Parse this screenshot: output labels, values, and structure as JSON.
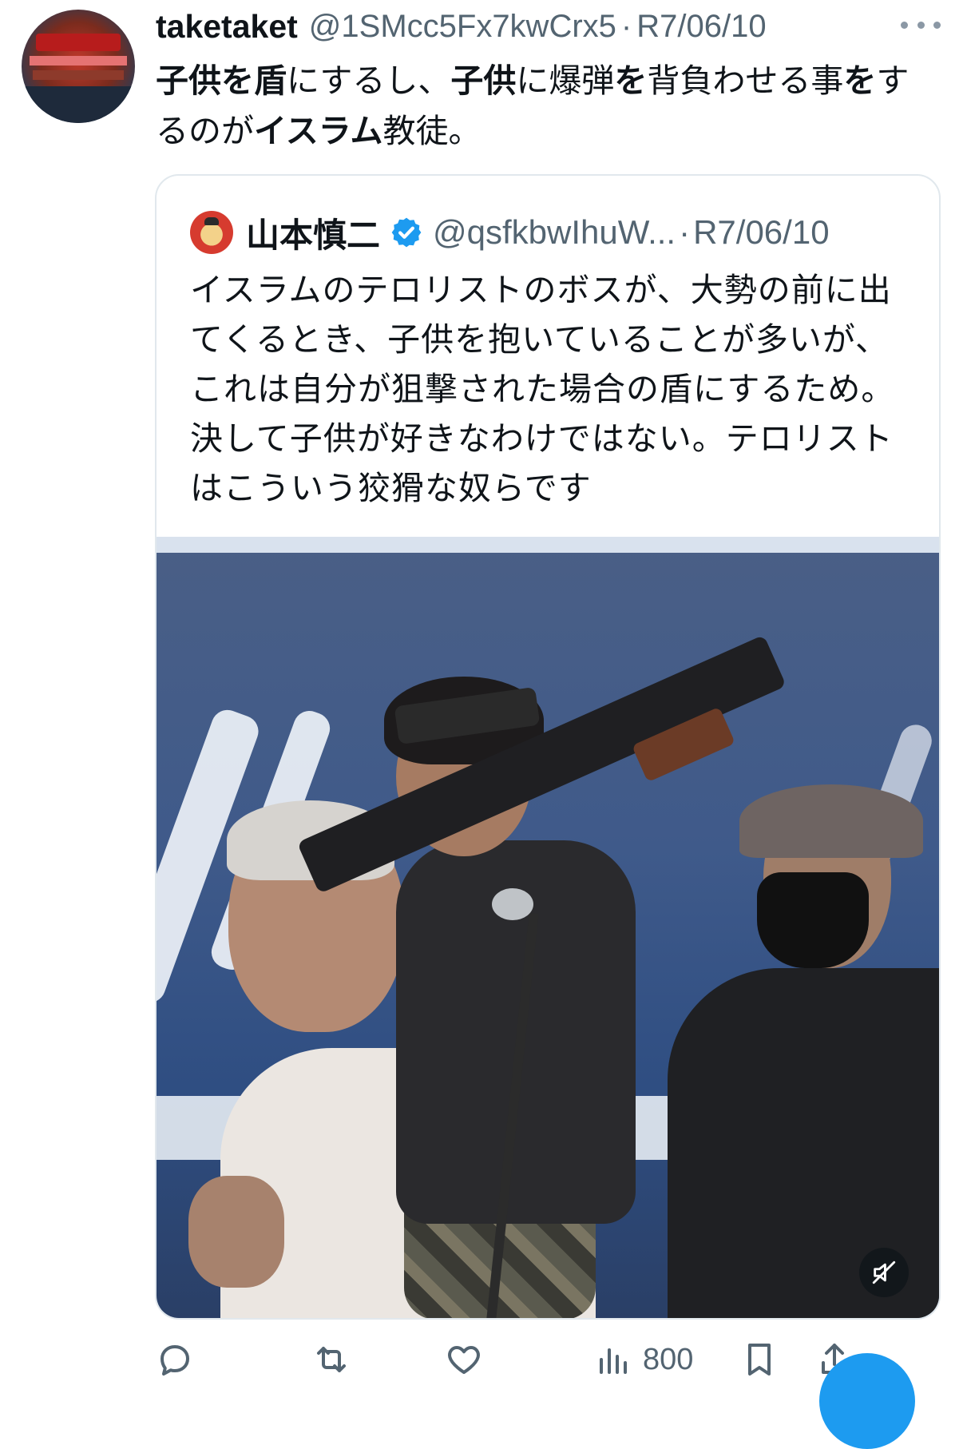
{
  "tweet": {
    "display_name": "taketaket",
    "handle": "@1SMcc5Fx7kwCrx5",
    "separator": "·",
    "date": "R7/06/10",
    "text_parts": [
      {
        "text": "子供を盾",
        "bold": true
      },
      {
        "text": "にするし、",
        "bold": false
      },
      {
        "text": "子供",
        "bold": true
      },
      {
        "text": "に爆弾",
        "bold": false
      },
      {
        "text": "を",
        "bold": true
      },
      {
        "text": "背負わせる事",
        "bold": false
      },
      {
        "text": "を",
        "bold": true
      },
      {
        "text": "するのが",
        "bold": false
      },
      {
        "text": "イスラム",
        "bold": true
      },
      {
        "text": "教徒。",
        "bold": false
      }
    ]
  },
  "quoted_tweet": {
    "display_name": "山本慎二",
    "handle": "@qsfkbwIhuW...",
    "separator": "·",
    "date": "R7/06/10",
    "text": "イスラムのテロリストのボスが、大勢の前に出てくるとき、子供を抱いていることが多いが、これは自分が狙撃された場合の盾にするため。決して子供が好きなわけではない。テロリストはこういう狡猾な奴らです"
  },
  "actions": {
    "views": "800"
  },
  "icons": {
    "more": "more-horizontal-icon",
    "verified": "verified-badge-icon",
    "mute": "video-muted-icon",
    "reply": "reply-icon",
    "retweet": "retweet-icon",
    "like": "like-icon",
    "views": "views-icon",
    "bookmark": "bookmark-icon",
    "share": "share-icon"
  },
  "colors": {
    "accent": "#1d9bf0",
    "secondary_text": "#536471",
    "primary_text": "#0f1419"
  }
}
